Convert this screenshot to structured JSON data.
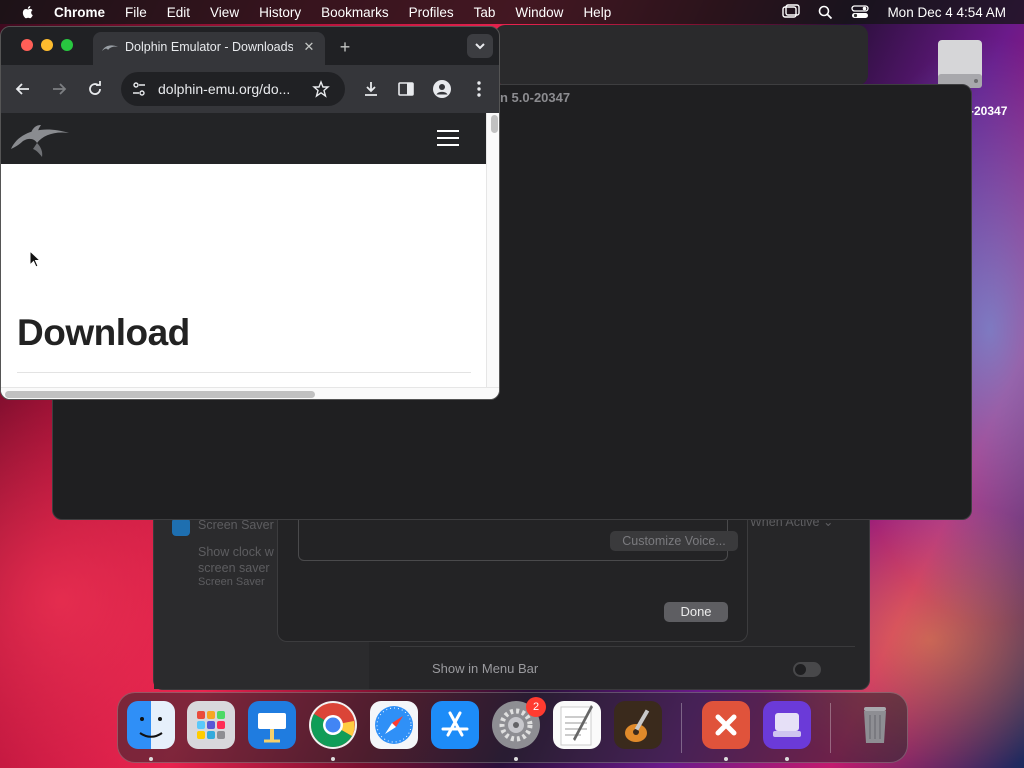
{
  "menubar": {
    "app": "Chrome",
    "items": [
      "File",
      "Edit",
      "View",
      "History",
      "Bookmarks",
      "Profiles",
      "Tab",
      "Window",
      "Help"
    ],
    "clock": "Mon Dec 4  4:54 AM"
  },
  "chrome": {
    "tab_title": "Dolphin Emulator - Downloads",
    "url": "dolphin-emu.org/do...",
    "page_heading": "Download"
  },
  "background": {
    "dolphin_window_title": "n 5.0-20347",
    "drive_label": "-20347",
    "sheet": {
      "customize_voice": "Customize Voice...",
      "done": "Done"
    },
    "settings": {
      "screen_saver_label": "Screen Saver",
      "show_clock_line1": "Show clock w",
      "show_clock_line2": "screen saver",
      "show_clock_line3": "Screen Saver",
      "when_active": "When Active ⌄",
      "show_in_menu_bar": "Show in Menu Bar"
    }
  },
  "dock": {
    "badge_system_settings": "2"
  },
  "colors": {
    "chrome_frame": "#202124",
    "chrome_toolbar": "#35363a",
    "site_header": "#232426",
    "badge": "#ff3b30"
  }
}
